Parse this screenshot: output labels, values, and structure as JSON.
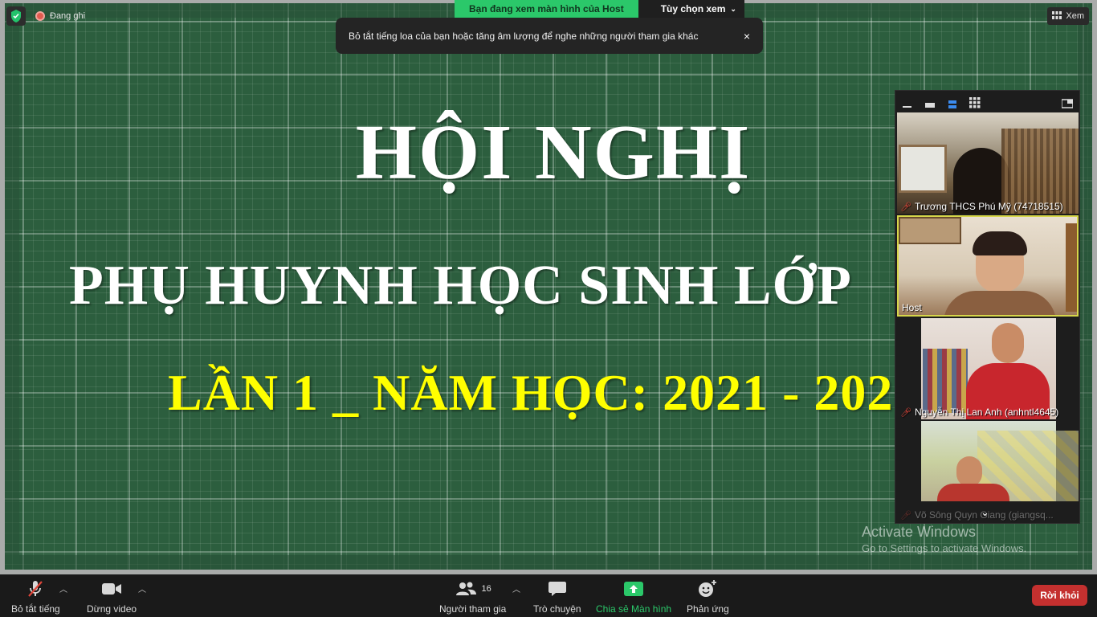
{
  "recording": {
    "label": "Đang ghi"
  },
  "share_banner": {
    "status": "Bạn đang xem màn hình của Host",
    "options_label": "Tùy chọn xem"
  },
  "toast": {
    "message": "Bỏ tắt tiếng loa của bạn hoặc tăng âm lượng để nghe những người tham gia khác",
    "close": "×"
  },
  "view_button": {
    "label": "Xem"
  },
  "slide": {
    "title": "HỘI NGHỊ",
    "subtitle": "PHỤ HUYNH HỌC SINH LỚP",
    "line3": "LẦN 1 _ NĂM HỌC: 2021 - 202"
  },
  "participants": [
    {
      "name": "Trương THCS Phú Mỹ (74718515)",
      "muted": true
    },
    {
      "name": "Host",
      "muted": false
    },
    {
      "name": "Nguyễn Thị Lan Anh (anhntl4645)",
      "muted": true
    },
    {
      "name": "Võ Sông Quyn Giang (giangsq...",
      "muted": true
    }
  ],
  "activate_windows": {
    "title": "Activate Windows",
    "subtitle": "Go to Settings to activate Windows."
  },
  "toolbar": {
    "mute_label": "Bỏ tắt tiếng",
    "video_label": "Dừng video",
    "participants_label": "Người tham gia",
    "participants_count": "16",
    "chat_label": "Trò chuyện",
    "share_label": "Chia sẻ Màn hình",
    "react_label": "Phản ứng",
    "leave_label": "Rời khỏi"
  },
  "colors": {
    "accent_green": "#2bc86a",
    "leave_red": "#c4302f",
    "slide_green": "#2c5e3e",
    "yellow_text": "#ffff00"
  }
}
